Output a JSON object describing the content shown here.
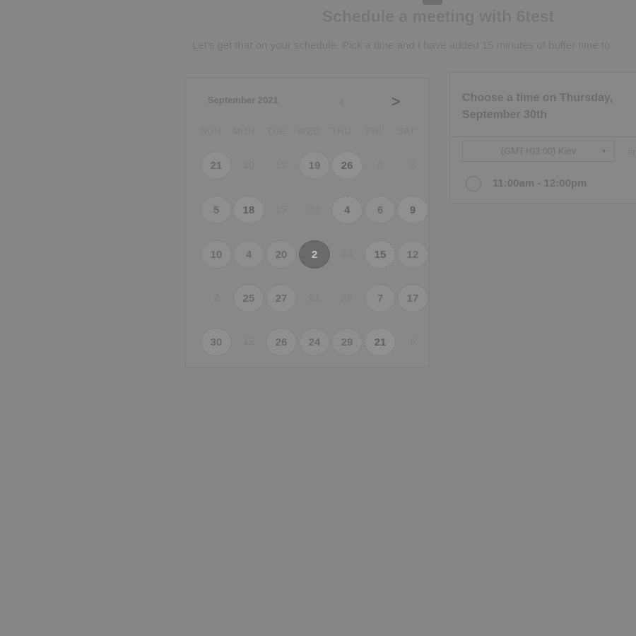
{
  "header": {
    "title": "Schedule a meeting with 6test",
    "subtitle": "Let's get that on your schedule. Pick a time and I have added 15 minutes of buffer time to"
  },
  "calendar": {
    "month_label": "September 2021",
    "prev_icon": "chevron-left-icon",
    "next_icon": "chevron-right-icon",
    "prev_glyph": "‹",
    "next_glyph": ">",
    "weekdays": [
      "SUN",
      "MON",
      "TUE",
      "WED",
      "THU",
      "FRI",
      "SAT"
    ],
    "weeks": [
      [
        {
          "label": "21",
          "state": "available"
        },
        {
          "label": "20",
          "state": "unavailable"
        },
        {
          "label": "12",
          "state": "unavailable"
        },
        {
          "label": "19",
          "state": "available"
        },
        {
          "label": "26",
          "state": "available-noisy"
        },
        {
          "label": "6",
          "state": "unavailable"
        },
        {
          "label": "3",
          "state": "unavailable"
        }
      ],
      [
        {
          "label": "5",
          "state": "available"
        },
        {
          "label": "18",
          "state": "available-noisy"
        },
        {
          "label": "19",
          "state": "unavailable"
        },
        {
          "label": "31",
          "state": "unavailable"
        },
        {
          "label": "4",
          "state": "available-noisy"
        },
        {
          "label": "6",
          "state": "available"
        },
        {
          "label": "9",
          "state": "available-noisy"
        }
      ],
      [
        {
          "label": "10",
          "state": "available"
        },
        {
          "label": "4",
          "state": "available"
        },
        {
          "label": "20",
          "state": "available"
        },
        {
          "label": "2",
          "state": "selected"
        },
        {
          "label": "24",
          "state": "unavailable"
        },
        {
          "label": "15",
          "state": "available-noisy"
        },
        {
          "label": "12",
          "state": "available"
        }
      ],
      [
        {
          "label": "2",
          "state": "unavailable"
        },
        {
          "label": "25",
          "state": "available"
        },
        {
          "label": "27",
          "state": "available"
        },
        {
          "label": "21",
          "state": "unavailable"
        },
        {
          "label": "29",
          "state": "unavailable"
        },
        {
          "label": "7",
          "state": "available"
        },
        {
          "label": "17",
          "state": "available"
        }
      ],
      [
        {
          "label": "30",
          "state": "available"
        },
        {
          "label": "12",
          "state": "unavailable"
        },
        {
          "label": "26",
          "state": "available"
        },
        {
          "label": "24",
          "state": "available"
        },
        {
          "label": "29",
          "state": "available"
        },
        {
          "label": "21",
          "state": "available-noisy"
        },
        {
          "label": "6",
          "state": "unavailable"
        }
      ]
    ]
  },
  "time_panel": {
    "heading": "Choose a time on Thursday, September 30th",
    "timezone_value": "(GMT+03:00) Kiev",
    "timezone_extra": "ar",
    "slots": [
      {
        "label": "11:00am - 12:00pm"
      }
    ]
  },
  "colors": {
    "background": "#878787",
    "selected_day": "#6a6a6a",
    "available_day": "#8e8e8e"
  }
}
